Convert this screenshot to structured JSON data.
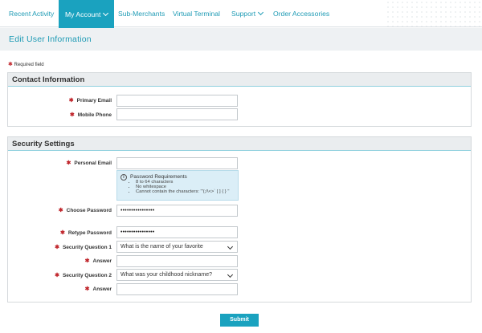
{
  "nav": {
    "items": [
      "Recent Activity",
      "My Account",
      "Sub-Merchants",
      "Virtual Terminal",
      "Support",
      "Order Accessories"
    ],
    "active_index": 1,
    "dropdown_items": [
      "My Account",
      "Support"
    ]
  },
  "page": {
    "title": "Edit User Information",
    "required_note": "Required field"
  },
  "contact": {
    "heading": "Contact Information",
    "primary_email_label": "Primary Email",
    "primary_email_value": "",
    "mobile_phone_label": "Mobile Phone",
    "mobile_phone_value": ""
  },
  "security": {
    "heading": "Security Settings",
    "personal_email_label": "Personal Email",
    "personal_email_value": "",
    "pw_requirements": {
      "title": "Password Requirements",
      "items": [
        "8 to 64 characters",
        "No whitespace",
        "Cannot contain the characters: '\"(;/\\<>` [ ] { } \" "
      ]
    },
    "choose_password_label": "Choose Password",
    "choose_password_value": "••••••••••••••••",
    "retype_password_label": "Retype Password",
    "retype_password_value": "••••••••••••••••",
    "q1_label": "Security Question 1",
    "q1_value": "What is the name of your favorite",
    "answer1_label": "Answer",
    "answer1_value": "",
    "q2_label": "Security Question 2",
    "q2_value": "What was your childhood nickname?",
    "answer2_label": "Answer",
    "answer2_value": ""
  },
  "submit_label": "Submit",
  "colors": {
    "accent": "#1aa2bf",
    "required": "#c0262c",
    "info_bg": "#dbeef7"
  },
  "icons": {
    "dropdown": "chevron-down-icon",
    "info": "info-icon",
    "required": "asterisk-icon"
  }
}
